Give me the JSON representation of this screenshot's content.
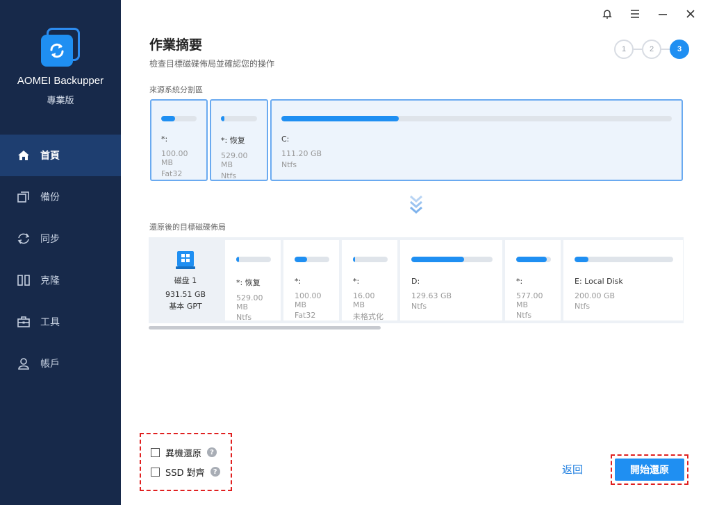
{
  "app": {
    "name": "AOMEI Backupper",
    "edition": "專業版",
    "accent": "#1f8ff2",
    "sidebar_bg": "#17294a"
  },
  "sidebar": {
    "items": [
      {
        "label": "首頁",
        "icon": "home-icon",
        "active": true
      },
      {
        "label": "備份",
        "icon": "backup-icon",
        "active": false
      },
      {
        "label": "同步",
        "icon": "sync-icon",
        "active": false
      },
      {
        "label": "克隆",
        "icon": "clone-icon",
        "active": false
      },
      {
        "label": "工具",
        "icon": "toolbox-icon",
        "active": false
      },
      {
        "label": "帳戶",
        "icon": "user-icon",
        "active": false
      }
    ]
  },
  "titlebar": {
    "icons": [
      "bell-icon",
      "menu-icon",
      "minimize-icon",
      "close-icon"
    ]
  },
  "page": {
    "title": "作業摘要",
    "subtitle": "檢查目標磁碟佈局並確認您的操作"
  },
  "steps": [
    "1",
    "2",
    "3"
  ],
  "active_step": 3,
  "source": {
    "label": "來源系統分割區",
    "partitions": [
      {
        "name": "*:",
        "size": "100.00 MB",
        "fs": "Fat32",
        "used": 0.4
      },
      {
        "name": "*: 恢复",
        "size": "529.00 MB",
        "fs": "Ntfs",
        "used": 0.1
      },
      {
        "name": "C:",
        "size": "111.20 GB",
        "fs": "Ntfs",
        "used": 0.3
      }
    ]
  },
  "target": {
    "label": "還原後的目標磁碟佈局",
    "disk": {
      "name": "磁盘 1",
      "size": "931.51 GB",
      "type": "基本 GPT"
    },
    "partitions": [
      {
        "name": "*: 恢复",
        "size": "529.00 MB",
        "fs": "Ntfs",
        "used": 0.08
      },
      {
        "name": "*:",
        "size": "100.00 MB",
        "fs": "Fat32",
        "used": 0.35
      },
      {
        "name": "*:",
        "size": "16.00 MB",
        "fs": "未格式化",
        "used": 0.06
      },
      {
        "name": "D:",
        "size": "129.63 GB",
        "fs": "Ntfs",
        "used": 0.65
      },
      {
        "name": "*:",
        "size": "577.00 MB",
        "fs": "Ntfs",
        "used": 0.88
      },
      {
        "name": "E: Local Disk",
        "size": "200.00 GB",
        "fs": "Ntfs",
        "used": 0.14
      }
    ]
  },
  "options": {
    "universal_restore": "異機還原",
    "ssd_align": "SSD 對齊",
    "help_glyph": "?"
  },
  "footer": {
    "back_label": "返回",
    "start_label": "開始還原"
  }
}
